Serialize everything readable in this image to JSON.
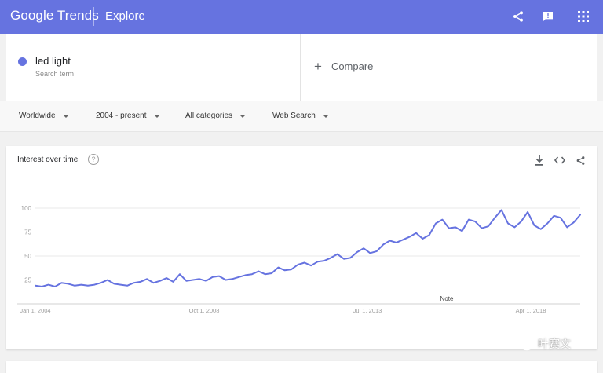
{
  "header": {
    "brand": "Google Trends",
    "section": "Explore",
    "accent": "#6673e0",
    "icons": [
      "share-icon",
      "feedback-icon",
      "apps-grid-icon"
    ]
  },
  "search": {
    "term": "led light",
    "term_sub": "Search term",
    "term_color": "#6673e0",
    "compare_label": "Compare"
  },
  "filters": {
    "region": "Worldwide",
    "time": "2004 - present",
    "category": "All categories",
    "search_type": "Web Search"
  },
  "interest": {
    "title": "Interest over time",
    "help": "?",
    "icons": [
      "download-icon",
      "embed-icon",
      "share-icon"
    ]
  },
  "chart_data": {
    "type": "line",
    "title": "",
    "xlabel": "",
    "ylabel": "",
    "ylim": [
      0,
      100
    ],
    "yticks": [
      100,
      75,
      50,
      25
    ],
    "xticks": [
      "Jan 1, 2004",
      "Oct 1, 2008",
      "Jul 1, 2013",
      "Apr 1, 2018"
    ],
    "grid": true,
    "annotation": "Note",
    "series": [
      {
        "name": "",
        "color": "#6673e0",
        "x_start": "2004-01",
        "x_end": "2019-06",
        "x_step": "quarter",
        "values": [
          19,
          18,
          20,
          18,
          22,
          21,
          19,
          20,
          19,
          20,
          22,
          25,
          21,
          20,
          19,
          22,
          23,
          26,
          22,
          24,
          27,
          23,
          31,
          24,
          25,
          26,
          24,
          28,
          29,
          25,
          26,
          28,
          30,
          31,
          34,
          31,
          32,
          38,
          35,
          36,
          41,
          43,
          40,
          44,
          45,
          48,
          52,
          47,
          48,
          54,
          58,
          53,
          55,
          62,
          66,
          64,
          67,
          70,
          74,
          68,
          72,
          84,
          88,
          79,
          80,
          76,
          88,
          86,
          79,
          81,
          90,
          98,
          84,
          80,
          86,
          96,
          82,
          78,
          84,
          92,
          90,
          80,
          85,
          93
        ]
      }
    ]
  },
  "watermark": {
    "text": "叶赛文"
  }
}
